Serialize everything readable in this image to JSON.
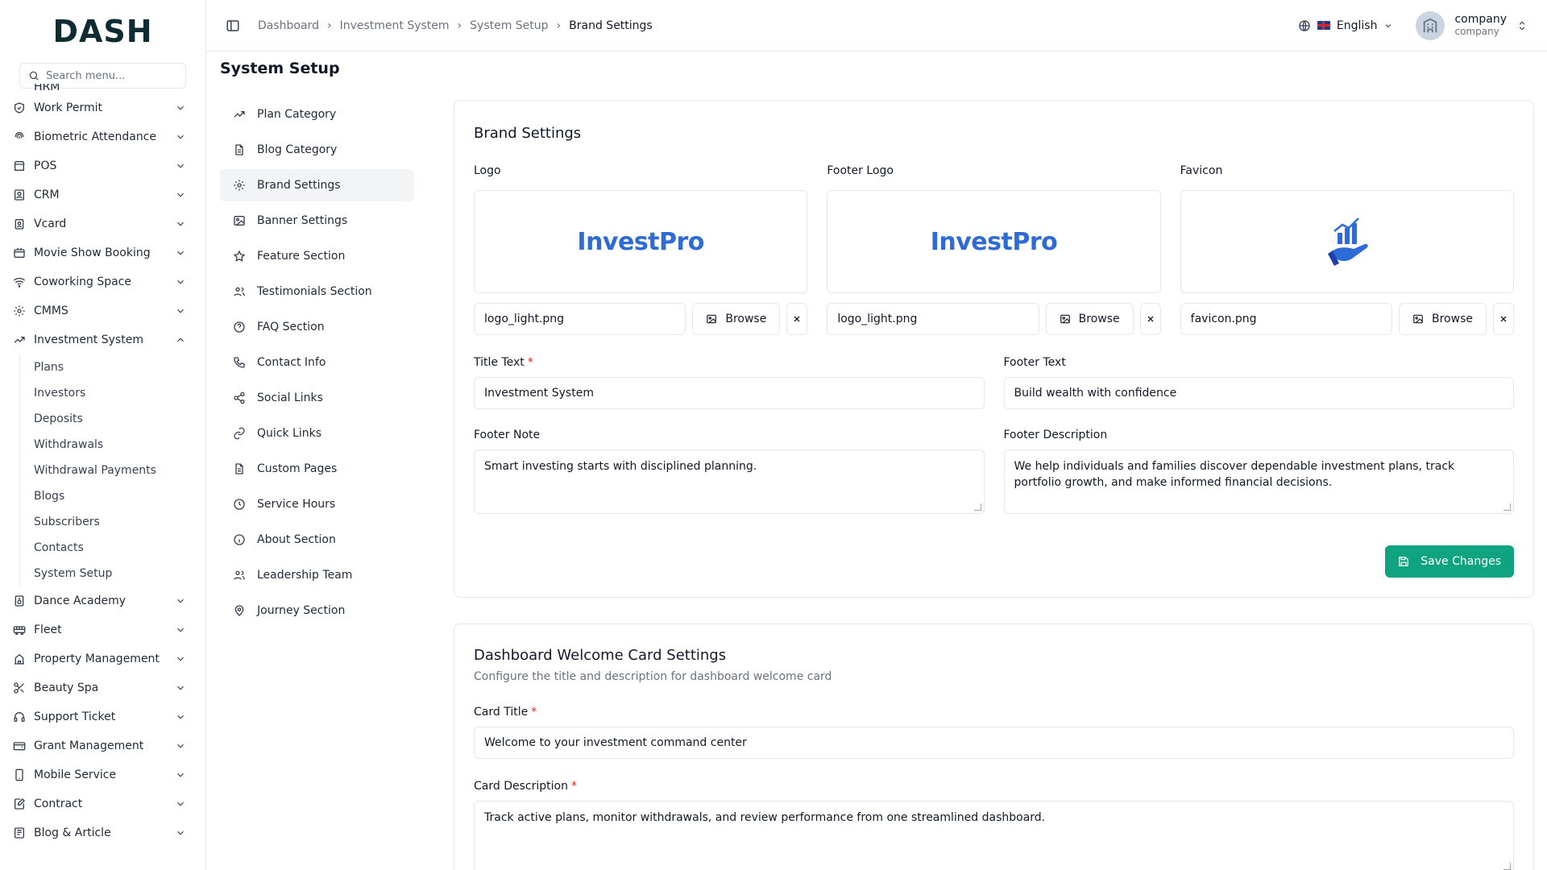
{
  "brand": {
    "name": "DASH"
  },
  "sidebar": {
    "search_placeholder": "Search menu...",
    "cut_item": "HRM",
    "items_before": [
      {
        "label": "Work Permit",
        "icon": "shield-icon"
      },
      {
        "label": "Biometric Attendance",
        "icon": "fingerprint-icon"
      },
      {
        "label": "POS",
        "icon": "store-icon"
      },
      {
        "label": "CRM",
        "icon": "contact-card-icon"
      },
      {
        "label": "Vcard",
        "icon": "id-badge-icon"
      },
      {
        "label": "Movie Show Booking",
        "icon": "film-icon"
      },
      {
        "label": "Coworking Space",
        "icon": "wifi-icon"
      },
      {
        "label": "CMMS",
        "icon": "gear-icon"
      }
    ],
    "active": {
      "label": "Investment System",
      "icon": "trending-up-icon"
    },
    "sub_items": [
      "Plans",
      "Investors",
      "Deposits",
      "Withdrawals",
      "Withdrawal Payments",
      "Blogs",
      "Subscribers",
      "Contacts",
      "System Setup"
    ],
    "items_after": [
      {
        "label": "Dance Academy",
        "icon": "music-icon"
      },
      {
        "label": "Fleet",
        "icon": "bus-icon"
      },
      {
        "label": "Property Management",
        "icon": "building-icon"
      },
      {
        "label": "Beauty Spa",
        "icon": "scissors-icon"
      },
      {
        "label": "Support Ticket",
        "icon": "headset-icon"
      },
      {
        "label": "Grant Management",
        "icon": "wallet-icon"
      },
      {
        "label": "Mobile Service",
        "icon": "phone-icon"
      },
      {
        "label": "Contract",
        "icon": "document-edit-icon"
      },
      {
        "label": "Blog & Article",
        "icon": "newspaper-icon"
      }
    ]
  },
  "header": {
    "breadcrumb": [
      "Dashboard",
      "Investment System",
      "System Setup",
      "Brand Settings"
    ],
    "language": "English",
    "user_name": "company",
    "user_role": "company"
  },
  "page": {
    "title": "System Setup"
  },
  "setup_nav": [
    {
      "label": "Plan Category",
      "icon": "trending-up-icon"
    },
    {
      "label": "Blog Category",
      "icon": "document-icon"
    },
    {
      "label": "Brand Settings",
      "icon": "gear-icon",
      "active": true
    },
    {
      "label": "Banner Settings",
      "icon": "image-icon"
    },
    {
      "label": "Feature Section",
      "icon": "star-icon"
    },
    {
      "label": "Testimonials Section",
      "icon": "users-icon"
    },
    {
      "label": "FAQ Section",
      "icon": "help-circle-icon"
    },
    {
      "label": "Contact Info",
      "icon": "phone-icon"
    },
    {
      "label": "Social Links",
      "icon": "share-icon"
    },
    {
      "label": "Quick Links",
      "icon": "link-icon"
    },
    {
      "label": "Custom Pages",
      "icon": "document-icon"
    },
    {
      "label": "Service Hours",
      "icon": "clock-icon"
    },
    {
      "label": "About Section",
      "icon": "info-icon"
    },
    {
      "label": "Leadership Team",
      "icon": "users-icon"
    },
    {
      "label": "Journey Section",
      "icon": "map-pin-icon"
    }
  ],
  "brand_settings": {
    "title": "Brand Settings",
    "logo_label": "Logo",
    "footer_logo_label": "Footer Logo",
    "favicon_label": "Favicon",
    "logo_text": "InvestPro",
    "logo_file": "logo_light.png",
    "footer_logo_file": "logo_light.png",
    "favicon_file": "favicon.png",
    "browse": "Browse",
    "title_text_label": "Title Text",
    "title_text_value": "Investment System",
    "footer_text_label": "Footer Text",
    "footer_text_value": "Build wealth with confidence",
    "footer_note_label": "Footer Note",
    "footer_note_value": "Smart investing starts with disciplined planning.",
    "footer_desc_label": "Footer Description",
    "footer_desc_value": "We help individuals and families discover dependable investment plans, track portfolio growth, and make informed financial decisions.",
    "save": "Save Changes"
  },
  "welcome_card": {
    "title": "Dashboard Welcome Card Settings",
    "subtitle": "Configure the title and description for dashboard welcome card",
    "card_title_label": "Card Title",
    "card_title_value": "Welcome to your investment command center",
    "card_desc_label": "Card Description",
    "card_desc_value": "Track active plans, monitor withdrawals, and review performance from one streamlined dashboard."
  },
  "colors": {
    "accent": "#10a37f",
    "logo_blue": "#2f6bd6",
    "required": "#dc2626"
  }
}
